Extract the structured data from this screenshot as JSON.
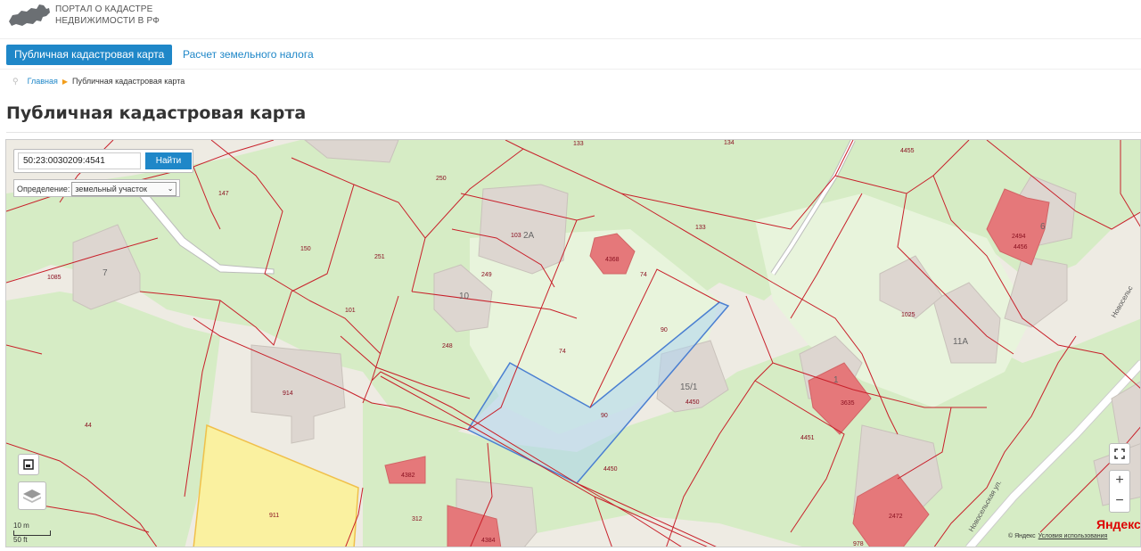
{
  "header": {
    "logo_line1": "ПОРТАЛ О КАДАСТРЕ",
    "logo_line2": "НЕДВИЖИМОСТИ В РФ"
  },
  "nav": {
    "tab_active": "Публичная кадастровая карта",
    "tab_link": "Расчет земельного налога"
  },
  "breadcrumb": {
    "home": "Главная",
    "current": "Публичная кадастровая карта"
  },
  "page_title": "Публичная кадастровая карта",
  "search": {
    "value": "50:23:0030209:4541",
    "button": "Найти"
  },
  "definition": {
    "label": "Определение:",
    "selected": "земельный участок"
  },
  "map": {
    "parcel_labels": [
      "133",
      "134",
      "4455",
      "250",
      "147",
      "103",
      "2А",
      "133",
      "4368",
      "2494",
      "4456",
      "6",
      "150",
      "251",
      "249",
      "74",
      "10",
      "1085",
      "7",
      "101",
      "248",
      "74",
      "90",
      "1025",
      "11А",
      "Новосельс",
      "15/1",
      "4450",
      "914",
      "90",
      "3635",
      "44",
      "4450",
      "4451",
      "4382",
      "312",
      "911",
      "4384",
      "2472",
      "978",
      "1",
      "Новосельская ул."
    ],
    "scale_m": "10 m",
    "scale_ft": "50 ft",
    "brand": "Яндекс",
    "copyright": "© Яндекс",
    "terms": "Условия использования"
  },
  "colors": {
    "accent": "#1f87c8",
    "parcel_border": "#c8202a",
    "selected_fill": "#aed6f1",
    "highlight_fill": "#fdf28f"
  }
}
